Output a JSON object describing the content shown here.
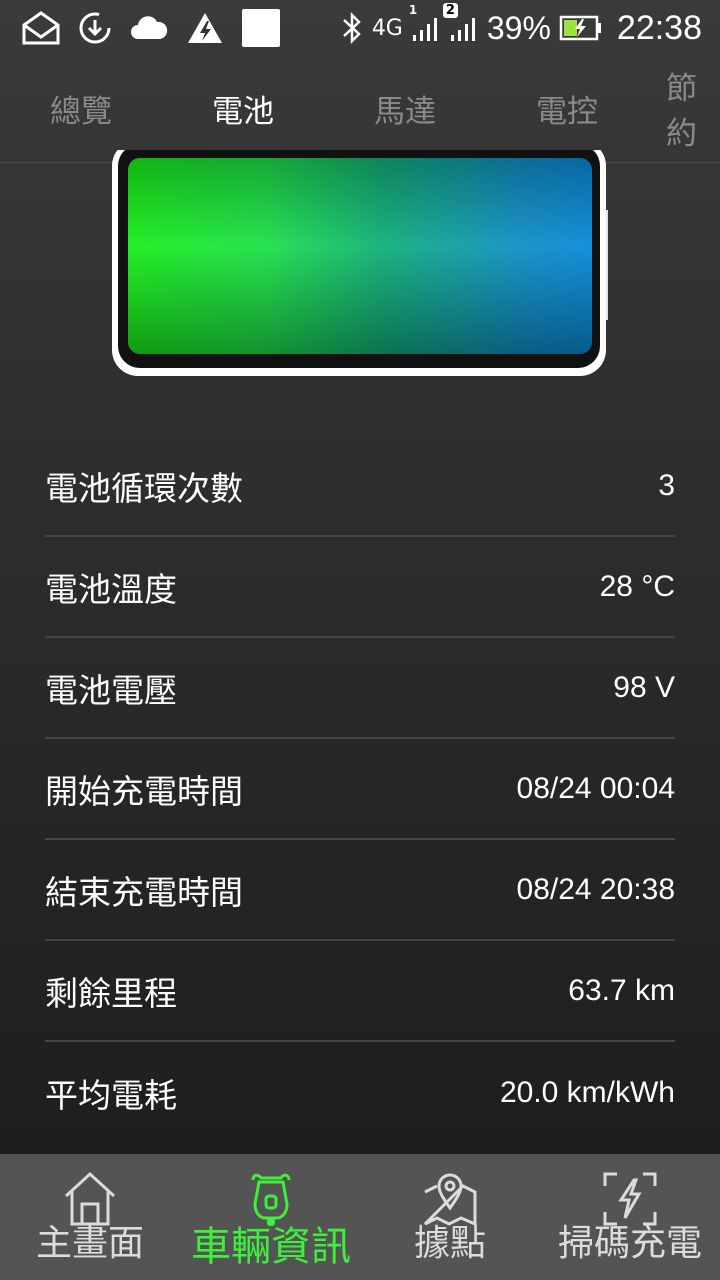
{
  "status_bar": {
    "network": "4G",
    "sim1_badge": "1",
    "sim2_badge": "2",
    "battery_percent": "39%",
    "time": "22:38"
  },
  "tabs": [
    {
      "label": "總覽"
    },
    {
      "label": "電池"
    },
    {
      "label": "馬達"
    },
    {
      "label": "電控"
    },
    {
      "label": "節約"
    }
  ],
  "active_tab": "電池",
  "colors": {
    "accent_blue": "#1e7ff0",
    "active_green": "#3cf03c",
    "battery_green": "#19f01a",
    "battery_blue": "#0a8ad8"
  },
  "battery_info": [
    {
      "label": "電池循環次數",
      "value": "3"
    },
    {
      "label": "電池溫度",
      "value": "28 °C"
    },
    {
      "label": "電池電壓",
      "value": "98 V"
    },
    {
      "label": "開始充電時間",
      "value": "08/24 00:04"
    },
    {
      "label": "結束充電時間",
      "value": "08/24 20:38"
    },
    {
      "label": "剩餘里程",
      "value": "63.7 km"
    },
    {
      "label": "平均電耗",
      "value": "20.0 km/kWh"
    }
  ],
  "bottom_nav": [
    {
      "label": "主畫面",
      "icon": "home-icon"
    },
    {
      "label": "車輛資訊",
      "icon": "scooter-icon"
    },
    {
      "label": "據點",
      "icon": "map-pin-icon"
    },
    {
      "label": "掃碼充電",
      "icon": "scan-charge-icon"
    }
  ]
}
